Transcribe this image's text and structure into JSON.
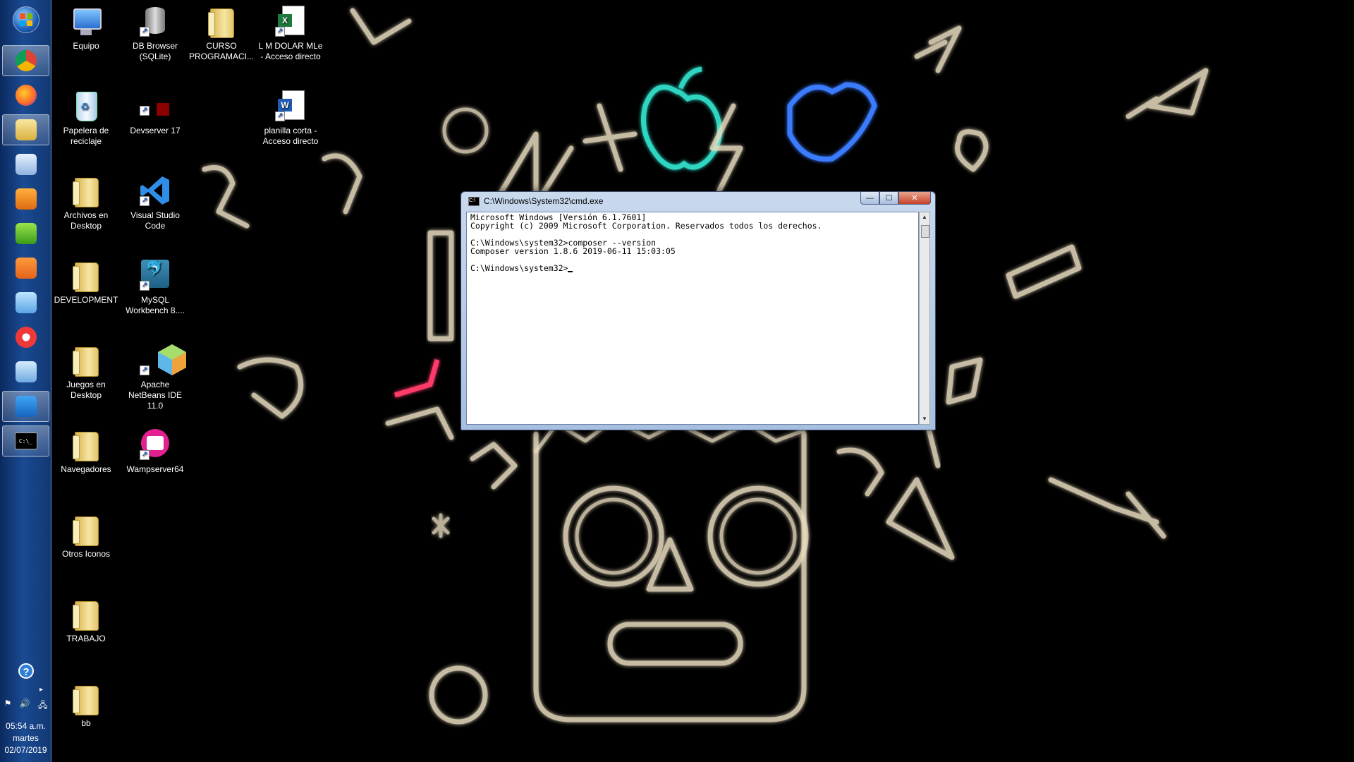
{
  "taskbar": {
    "start_label": "Start",
    "items": [
      {
        "name": "chrome",
        "icon": "chrome-icon",
        "active": true
      },
      {
        "name": "firefox",
        "icon": "firefox-icon",
        "active": false
      },
      {
        "name": "explorer",
        "icon": "folder-explorer-icon",
        "active": true
      },
      {
        "name": "calculator",
        "icon": "calculator-icon",
        "active": false
      },
      {
        "name": "media-player",
        "icon": "media-player-icon",
        "active": false
      },
      {
        "name": "bluestacks",
        "icon": "layers-icon",
        "active": false
      },
      {
        "name": "sublime-text",
        "icon": "sublime-icon",
        "active": false
      },
      {
        "name": "notepad",
        "icon": "notepad-icon",
        "active": false
      },
      {
        "name": "vivaldi",
        "icon": "vivaldi-icon",
        "active": false
      },
      {
        "name": "paint",
        "icon": "paint-icon",
        "active": false
      },
      {
        "name": "vscode",
        "icon": "vscode-icon",
        "active": true
      },
      {
        "name": "cmd",
        "icon": "cmd-icon",
        "active": true
      }
    ],
    "help_icon": "help-icon",
    "tray": {
      "flag": "⚑",
      "volume": "🔊",
      "network": "🖧",
      "arrow": "▸"
    },
    "clock": {
      "time": "05:54 a.m.",
      "day": "martes",
      "date": "02/07/2019"
    }
  },
  "desktop": {
    "col1": [
      {
        "label": "Equipo",
        "icon": "computer-icon"
      },
      {
        "label": "Papelera de reciclaje",
        "icon": "recycle-bin-icon"
      },
      {
        "label": "Archivos en Desktop",
        "icon": "folder-icon"
      },
      {
        "label": "DEVELOPMENT",
        "icon": "folder-icon"
      },
      {
        "label": "Juegos en Desktop",
        "icon": "folder-icon"
      },
      {
        "label": "Navegadores",
        "icon": "folder-icon"
      },
      {
        "label": "Otros Iconos",
        "icon": "folder-icon"
      },
      {
        "label": "TRABAJO",
        "icon": "folder-icon"
      },
      {
        "label": "bb",
        "icon": "folder-icon"
      }
    ],
    "col2": [
      {
        "label": "DB Browser (SQLite)",
        "icon": "database-icon"
      },
      {
        "label": "Devserver 17",
        "icon": "devserver-icon"
      },
      {
        "label": "Visual Studio Code",
        "icon": "vscode-icon"
      },
      {
        "label": "MySQL Workbench 8....",
        "icon": "mysql-workbench-icon"
      },
      {
        "label": "Apache NetBeans IDE 11.0",
        "icon": "netbeans-icon"
      },
      {
        "label": "Wampserver64",
        "icon": "wampserver-icon"
      }
    ],
    "col3": [
      {
        "label": "CURSO PROGRAMACI...",
        "icon": "folder-icon"
      }
    ],
    "col4": [
      {
        "label": "L M DOLAR MLe - Acceso directo",
        "icon": "excel-icon"
      },
      {
        "label": "planilla corta - Acceso directo",
        "icon": "word-icon"
      }
    ]
  },
  "cmd_window": {
    "title": "C:\\Windows\\System32\\cmd.exe",
    "controls": {
      "minimize": "—",
      "maximize": "☐",
      "close": "✕"
    },
    "lines": [
      "Microsoft Windows [Versión 6.1.7601]",
      "Copyright (c) 2009 Microsoft Corporation. Reservados todos los derechos.",
      "",
      "C:\\Windows\\system32>composer --version",
      "Composer version 1.8.6 2019-06-11 15:03:05",
      "",
      "C:\\Windows\\system32>"
    ]
  }
}
